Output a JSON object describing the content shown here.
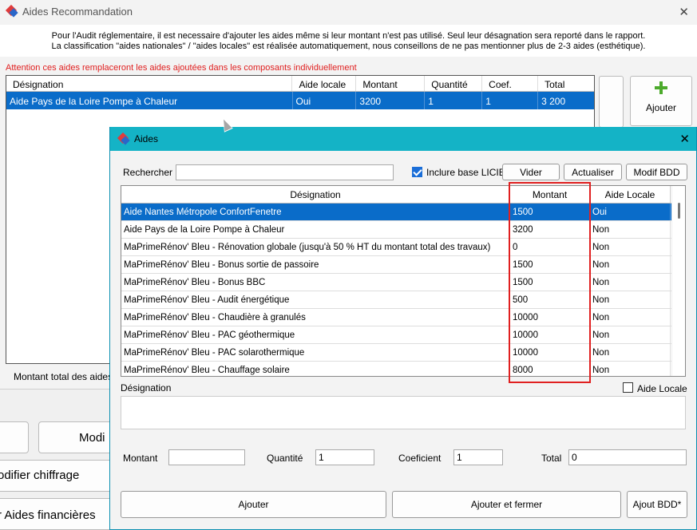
{
  "back_window": {
    "title": "Aides Recommandation",
    "info_line1": "Pour l'Audit réglementaire, il est necessaire d'ajouter les aides même si leur montant n'est pas utilisé. Seul leur désagnation sera reporté dans le rapport.",
    "info_line2": "La classification \"aides nationales\" / \"aides locales\" est réalisée automatiquement, nous conseillons de ne pas mentionner plus de 2-3 aides (esthétique).",
    "warning": "Attention ces aides remplaceront les aides ajoutées dans les composants individuellement",
    "table": {
      "headers": [
        "Désignation",
        "Aide locale",
        "Montant",
        "Quantité",
        "Coef.",
        "Total"
      ],
      "rows": [
        [
          "Aide Pays de la Loire Pompe à Chaleur",
          "Oui",
          "3200",
          "1",
          "1",
          "3 200"
        ]
      ]
    },
    "add_button": "Ajouter",
    "total_label": "Montant total des aides",
    "bg_button_modif": "Modi",
    "bg_button_chiffrage": "odifier chiffrage",
    "bg_button_aides": "r Aides financières"
  },
  "dialog": {
    "title": "Aides",
    "search_label": "Rechercher",
    "search_value": "",
    "include_liciel_label": "Inclure base LICIEL",
    "include_liciel_checked": true,
    "btn_vider": "Vider",
    "btn_actualiser": "Actualiser",
    "btn_modif_bdd": "Modif BDD",
    "grid": {
      "headers": [
        "Désignation",
        "Montant",
        "Aide Locale"
      ],
      "rows": [
        [
          "Aide Nantes Métropole ConfortFenetre",
          "1500",
          "Oui"
        ],
        [
          "Aide Pays de la Loire Pompe à Chaleur",
          "3200",
          "Non"
        ],
        [
          "MaPrimeRénov' Bleu - Rénovation globale (jusqu'à 50 % HT du montant total des travaux)",
          "0",
          "Non"
        ],
        [
          "MaPrimeRénov' Bleu - Bonus sortie de passoire",
          "1500",
          "Non"
        ],
        [
          "MaPrimeRénov' Bleu - Bonus BBC",
          "1500",
          "Non"
        ],
        [
          "MaPrimeRénov' Bleu - Audit énergétique",
          "500",
          "Non"
        ],
        [
          "MaPrimeRénov' Bleu - Chaudière à granulés",
          "10000",
          "Non"
        ],
        [
          "MaPrimeRénov' Bleu - PAC géothermique",
          "10000",
          "Non"
        ],
        [
          "MaPrimeRénov' Bleu - PAC solarothermique",
          "10000",
          "Non"
        ],
        [
          "MaPrimeRénov' Bleu - Chauffage solaire",
          "8000",
          "Non"
        ]
      ]
    },
    "designation_label": "Désignation",
    "aide_locale_label": "Aide Locale",
    "aide_locale_checked": false,
    "designation_value": "",
    "montant_label": "Montant",
    "montant_value": "",
    "quantite_label": "Quantité",
    "quantite_value": "1",
    "coef_label": "Coeficient",
    "coef_value": "1",
    "total_label": "Total",
    "total_value": "0",
    "btn_ajouter": "Ajouter",
    "btn_ajouter_fermer": "Ajouter et fermer",
    "btn_ajout_bdd": "Ajout BDD*"
  },
  "colors": {
    "accent": "#14b3c6",
    "selection": "#0a6cc9",
    "warning": "#e02020"
  }
}
